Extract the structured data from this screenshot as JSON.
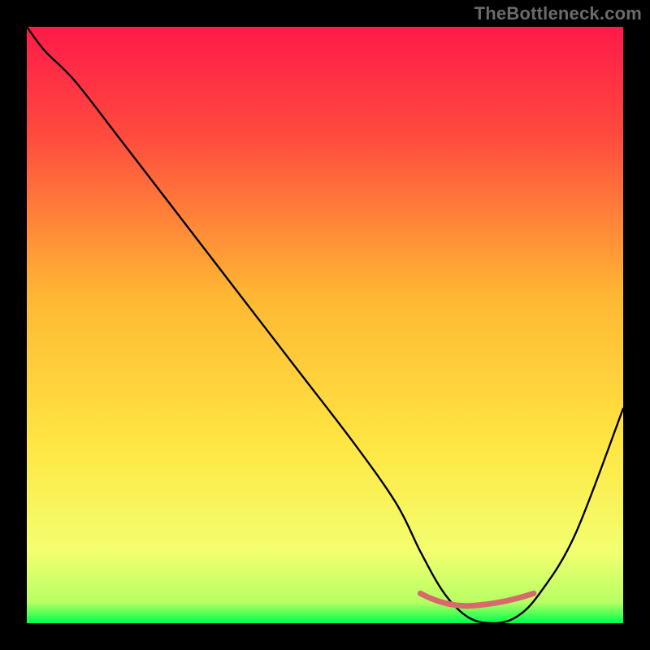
{
  "watermark": "TheBottleneck.com",
  "colors": {
    "bg": "#000000",
    "grad_top": "#ff1a49",
    "grad_mid": "#ffd22c",
    "grad_low": "#f6ff7a",
    "grad_bottom": "#00ff4c",
    "curve": "#000000",
    "flat_zone": "#d96a6c",
    "watermark": "#6b6b6b"
  },
  "chart_data": {
    "type": "line",
    "title": "",
    "xlabel": "",
    "ylabel": "",
    "xlim": [
      0,
      100
    ],
    "ylim": [
      0,
      100
    ],
    "x": [
      0,
      3,
      8,
      15,
      25,
      35,
      45,
      55,
      62,
      66,
      70,
      74,
      78,
      82,
      86,
      92,
      100
    ],
    "values": [
      100,
      96,
      91,
      82,
      69,
      56,
      43,
      30,
      20,
      12,
      5,
      1,
      0,
      1,
      5,
      15,
      36
    ],
    "note": "Values estimated from pixel positions; chart has no numeric axis labels. y=0 is the bottom (green) edge, y=100 is the top (red) edge. Minimum of the curve occurs near x≈78.",
    "flat_zone": {
      "x_start": 66,
      "x_end": 85,
      "y": 3
    }
  }
}
